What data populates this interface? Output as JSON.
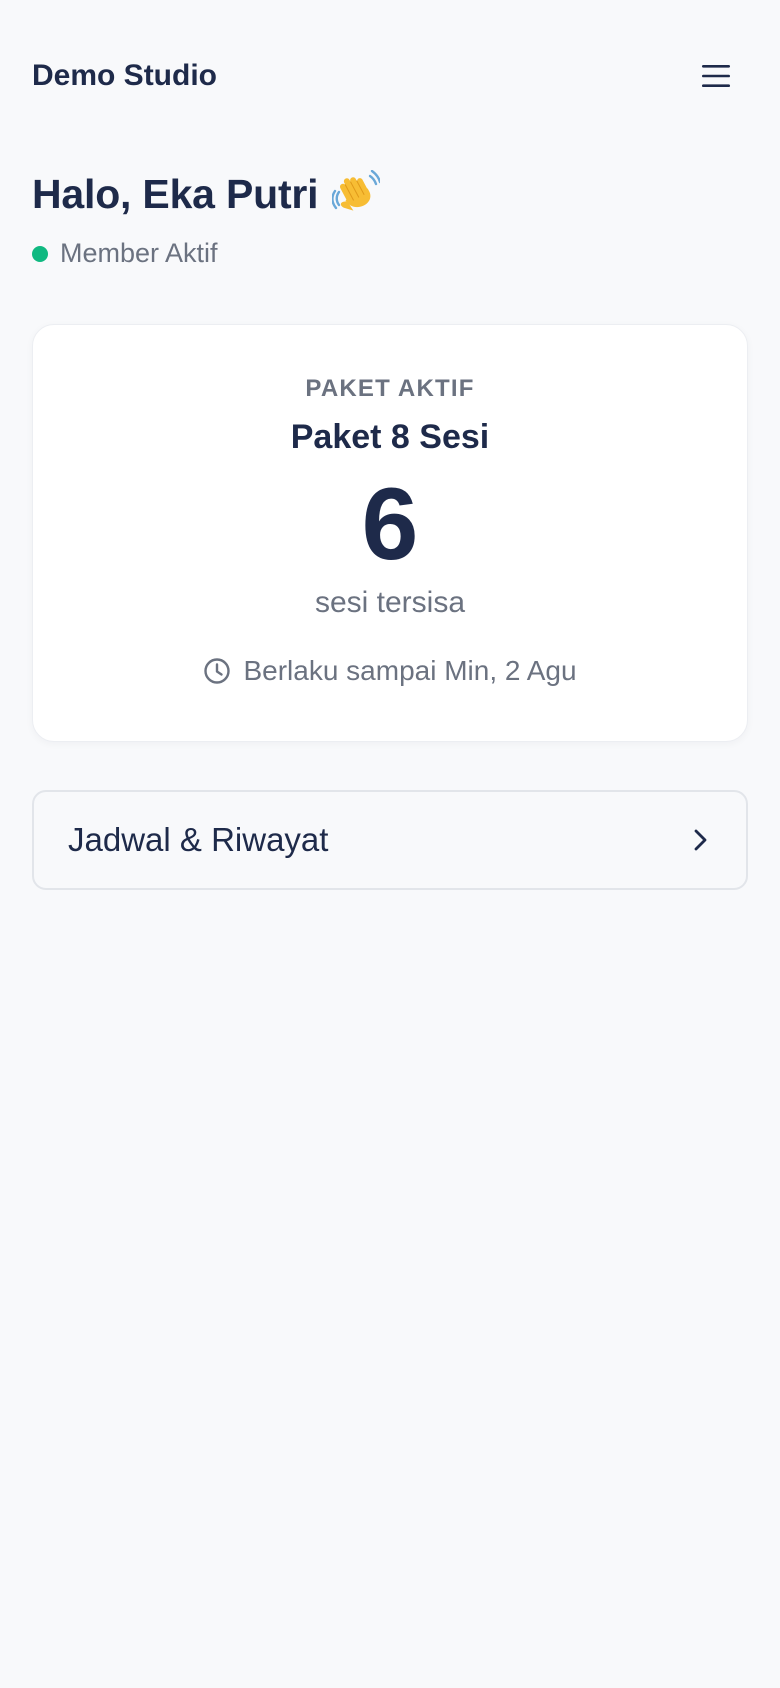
{
  "header": {
    "brand": "Demo Studio",
    "menu_icon": "hamburger-menu-icon"
  },
  "greeting": {
    "text": "Halo, Eka Putri",
    "emoji_icon": "waving-hand-icon"
  },
  "status": {
    "label": "Member Aktif",
    "color": "#10b981"
  },
  "package": {
    "label": "PAKET AKTIF",
    "name": "Paket 8 Sesi",
    "remaining": "6",
    "remaining_label": "sesi tersisa",
    "validity": "Berlaku sampai Min, 2 Agu",
    "validity_icon": "clock-icon"
  },
  "links": {
    "schedule_label": "Jadwal & Riwayat",
    "schedule_icon": "chevron-right-icon"
  },
  "colors": {
    "primary_text": "#1e2a4a",
    "muted_text": "#6b7280",
    "background": "#f8f9fb",
    "card": "#ffffff"
  }
}
